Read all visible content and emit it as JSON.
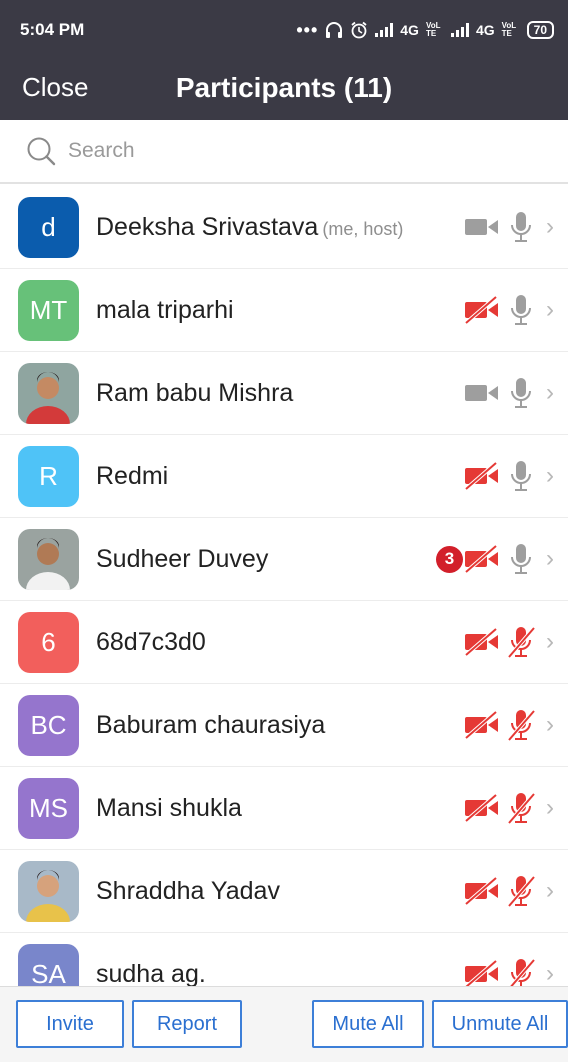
{
  "status_bar": {
    "time": "5:04 PM",
    "network_1": "4G",
    "volte_1": "VoLTE",
    "network_2": "4G",
    "volte_2": "VoLTE",
    "battery": "70"
  },
  "header": {
    "close_label": "Close",
    "title": "Participants (11)"
  },
  "search": {
    "placeholder": "Search"
  },
  "colors": {
    "header_bg": "#3b3a45",
    "muted_red": "#e53935",
    "active_gray": "#9e9e9e",
    "button_blue": "#2a6fd0"
  },
  "participants": [
    {
      "initials": "d",
      "name": "Deeksha Srivastava",
      "tag": "(me, host)",
      "avatar_color": "#0b5cad",
      "video": "on",
      "audio": "on"
    },
    {
      "initials": "MT",
      "name": "mala triparhi",
      "tag": "",
      "avatar_color": "#67c179",
      "video": "off",
      "audio": "on"
    },
    {
      "initials": "",
      "name": "Ram babu Mishra",
      "tag": "",
      "avatar_color": "photo",
      "video": "on",
      "audio": "on"
    },
    {
      "initials": "R",
      "name": "Redmi",
      "tag": "",
      "avatar_color": "#4fc3f7",
      "video": "off",
      "audio": "on"
    },
    {
      "initials": "",
      "name": "Sudheer Duvey",
      "tag": "",
      "avatar_color": "photo",
      "video": "off",
      "audio": "on",
      "badge": "3"
    },
    {
      "initials": "6",
      "name": "68d7c3d0",
      "tag": "",
      "avatar_color": "#f25f5c",
      "video": "off",
      "audio": "off"
    },
    {
      "initials": "BC",
      "name": "Baburam chaurasiya",
      "tag": "",
      "avatar_color": "#9575cd",
      "video": "off",
      "audio": "off"
    },
    {
      "initials": "MS",
      "name": "Mansi shukla",
      "tag": "",
      "avatar_color": "#9575cd",
      "video": "off",
      "audio": "off"
    },
    {
      "initials": "",
      "name": "Shraddha Yadav",
      "tag": "",
      "avatar_color": "photo",
      "video": "off",
      "audio": "off"
    },
    {
      "initials": "SA",
      "name": "sudha ag.",
      "tag": "",
      "avatar_color": "#7986cb",
      "video": "off",
      "audio": "off"
    }
  ],
  "footer": {
    "invite_label": "Invite",
    "report_label": "Report",
    "mute_all_label": "Mute All",
    "unmute_all_label": "Unmute All"
  }
}
